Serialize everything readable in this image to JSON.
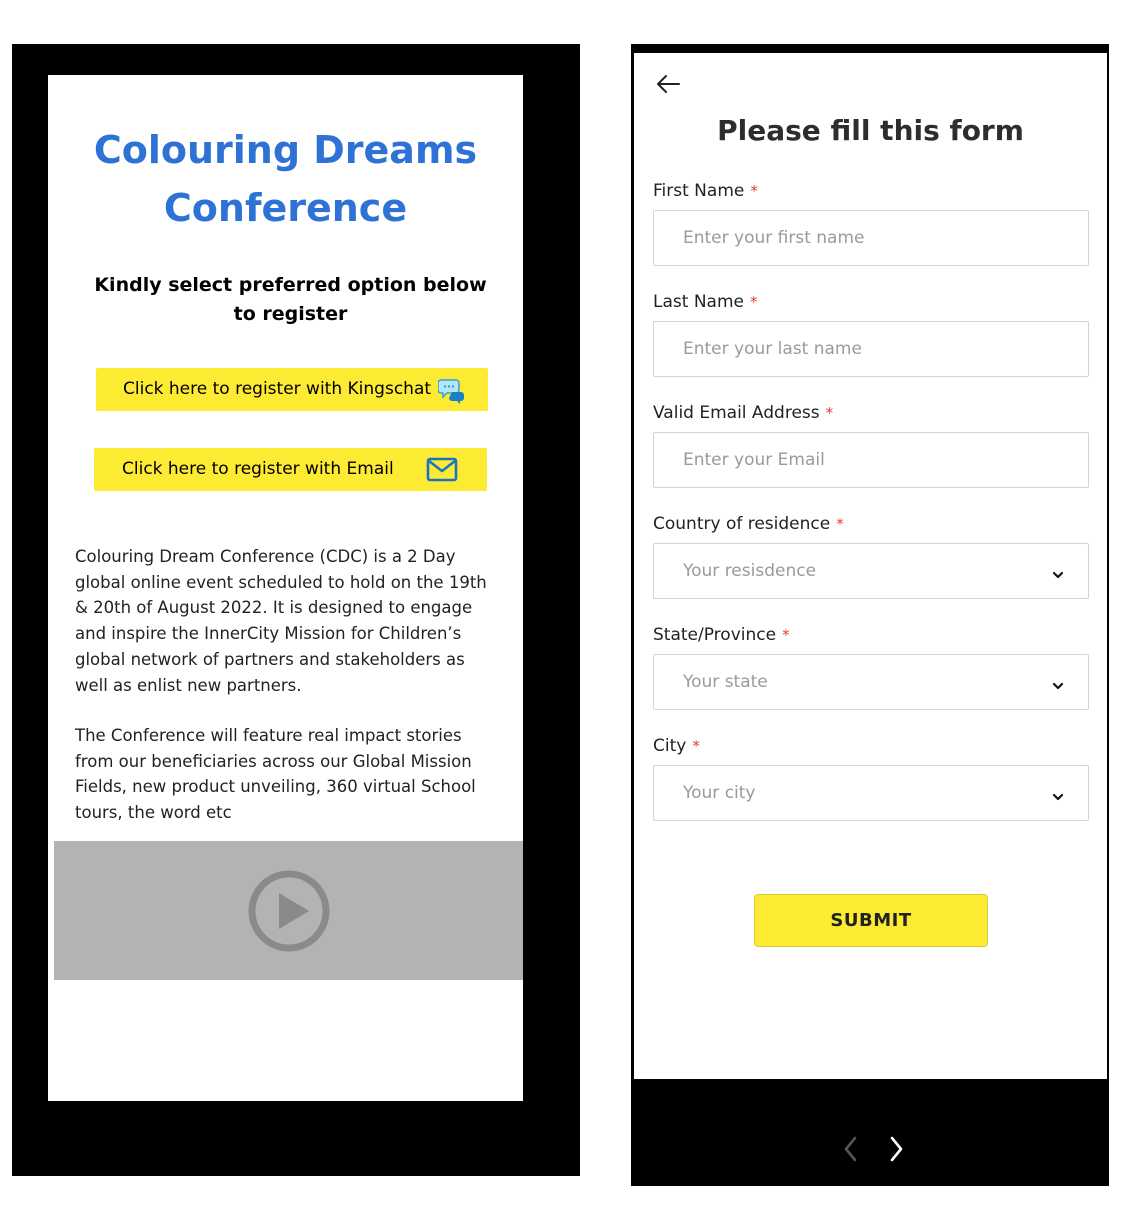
{
  "left_screen": {
    "title_line1": "Colouring Dreams",
    "title_line2": "Conference",
    "subtitle": "Kindly select preferred option below to register",
    "kingschat_button": "Click here to register with Kingschat",
    "email_button": "Click here to register with Email",
    "description_1": "Colouring Dream Conference (CDC) is a 2 Day global online event scheduled to hold on the 19th & 20th of August 2022. It is designed to engage and inspire the InnerCity Mission for Children’s global network of partners and stakeholders as well as enlist new partners.",
    "description_2": "The Conference will feature real impact stories from our beneficiaries across our Global Mission Fields, new product unveiling, 360 virtual School tours, the word etc",
    "video_icon": "play-icon"
  },
  "right_screen": {
    "back_icon": "arrow-left-icon",
    "form_title": "Please fill this form",
    "required_marker": "*",
    "fields": {
      "first_name": {
        "label": "First Name",
        "placeholder": "Enter your first name"
      },
      "last_name": {
        "label": "Last Name",
        "placeholder": "Enter your last name"
      },
      "email": {
        "label": "Valid Email Address",
        "placeholder": "Enter your Email"
      },
      "country": {
        "label": "Country of residence",
        "placeholder": "Your resisdence"
      },
      "state": {
        "label": "State/Province",
        "placeholder": "Your state"
      },
      "city": {
        "label": "City",
        "placeholder": "Your city"
      }
    },
    "submit_label": "SUBMIT"
  },
  "pager": {
    "prev_icon": "chevron-left-icon",
    "next_icon": "chevron-right-icon"
  },
  "colors": {
    "title_blue": "#2f72d6",
    "button_yellow": "#fdeb33",
    "required_red": "#e53935",
    "video_grey": "#b3b3b3"
  }
}
